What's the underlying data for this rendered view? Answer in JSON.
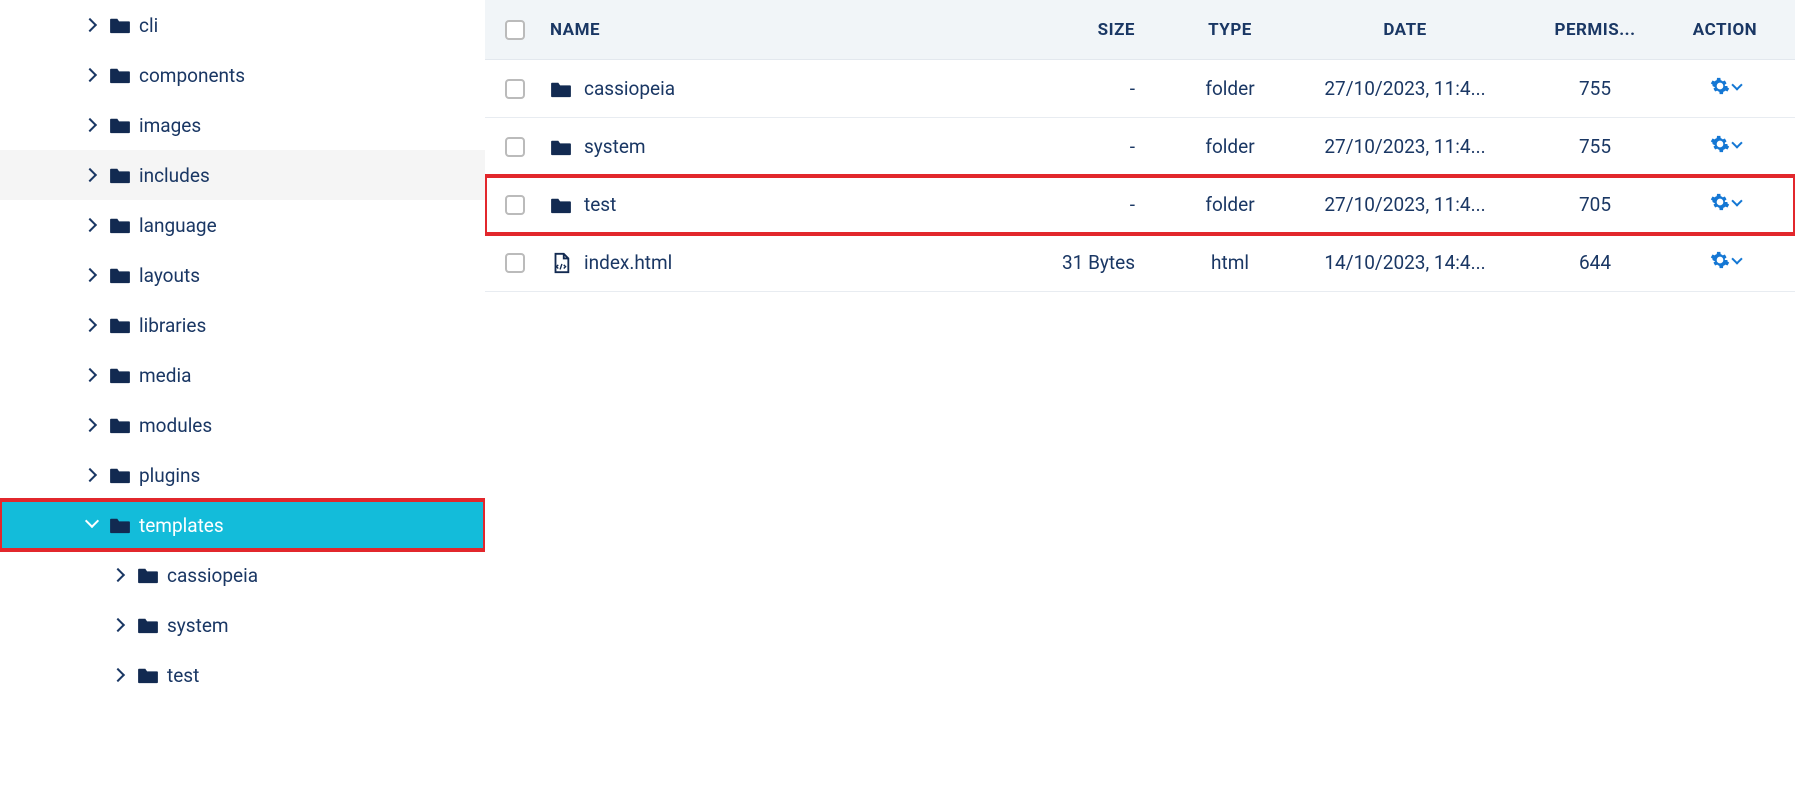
{
  "sidebar": {
    "items": [
      {
        "label": "cli",
        "level": 1,
        "expanded": false,
        "active": false,
        "highlight": false
      },
      {
        "label": "components",
        "level": 1,
        "expanded": false,
        "active": false,
        "highlight": false
      },
      {
        "label": "images",
        "level": 1,
        "expanded": false,
        "active": false,
        "highlight": false
      },
      {
        "label": "includes",
        "level": 1,
        "expanded": false,
        "active": false,
        "highlight": false,
        "hover": true
      },
      {
        "label": "language",
        "level": 1,
        "expanded": false,
        "active": false,
        "highlight": false
      },
      {
        "label": "layouts",
        "level": 1,
        "expanded": false,
        "active": false,
        "highlight": false
      },
      {
        "label": "libraries",
        "level": 1,
        "expanded": false,
        "active": false,
        "highlight": false
      },
      {
        "label": "media",
        "level": 1,
        "expanded": false,
        "active": false,
        "highlight": false
      },
      {
        "label": "modules",
        "level": 1,
        "expanded": false,
        "active": false,
        "highlight": false
      },
      {
        "label": "plugins",
        "level": 1,
        "expanded": false,
        "active": false,
        "highlight": false
      },
      {
        "label": "templates",
        "level": 1,
        "expanded": true,
        "active": true,
        "highlight": true
      },
      {
        "label": "cassiopeia",
        "level": 2,
        "expanded": false,
        "active": false,
        "highlight": false
      },
      {
        "label": "system",
        "level": 2,
        "expanded": false,
        "active": false,
        "highlight": false
      },
      {
        "label": "test",
        "level": 2,
        "expanded": false,
        "active": false,
        "highlight": false
      }
    ]
  },
  "table": {
    "headers": {
      "name": "NAME",
      "size": "SIZE",
      "type": "TYPE",
      "date": "DATE",
      "permis": "PERMIS...",
      "action": "ACTION"
    },
    "rows": [
      {
        "name": "cassiopeia",
        "size": "-",
        "type": "folder",
        "date": "27/10/2023, 11:4...",
        "permis": "755",
        "kind": "folder",
        "highlight": false
      },
      {
        "name": "system",
        "size": "-",
        "type": "folder",
        "date": "27/10/2023, 11:4...",
        "permis": "755",
        "kind": "folder",
        "highlight": false
      },
      {
        "name": "test",
        "size": "-",
        "type": "folder",
        "date": "27/10/2023, 11:4...",
        "permis": "705",
        "kind": "folder",
        "highlight": true
      },
      {
        "name": "index.html",
        "size": "31 Bytes",
        "type": "html",
        "date": "14/10/2023, 14:4...",
        "permis": "644",
        "kind": "file",
        "highlight": false
      }
    ]
  }
}
